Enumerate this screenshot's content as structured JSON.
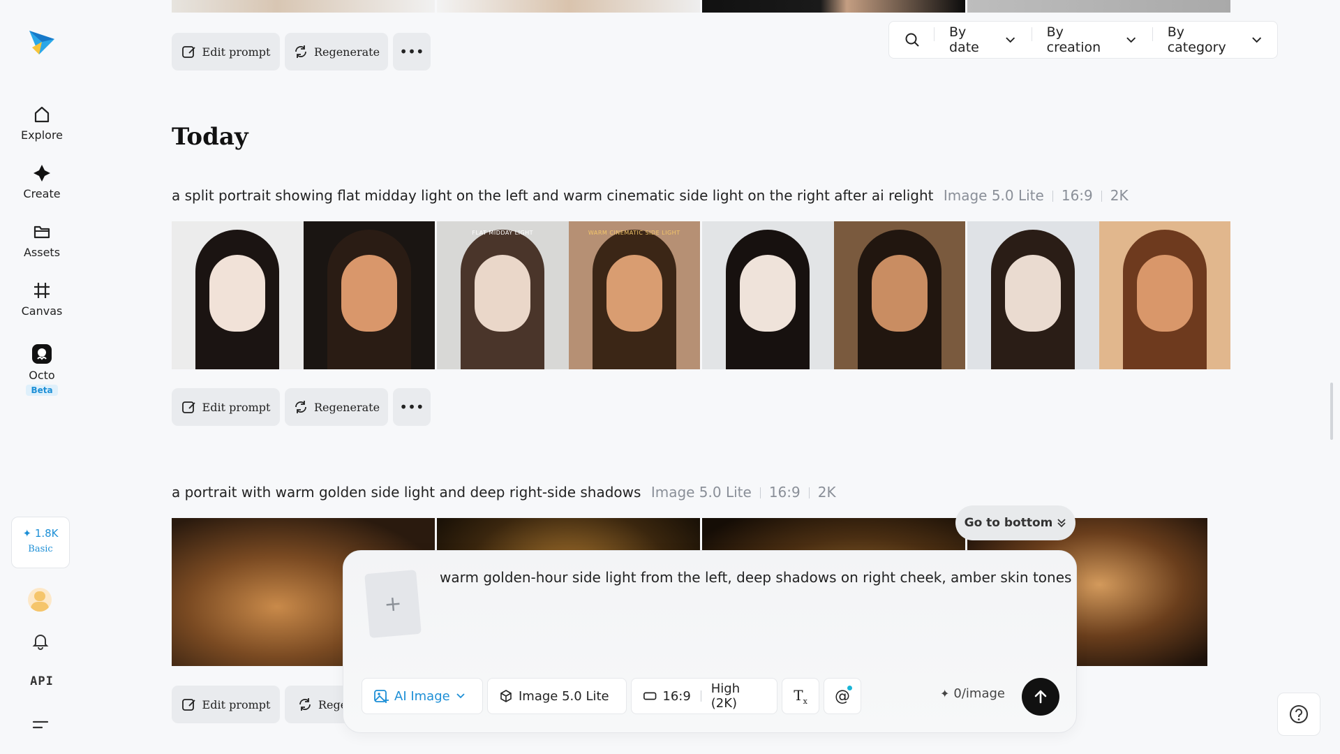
{
  "sidebar": {
    "items": [
      {
        "label": "Explore",
        "icon": "home-icon"
      },
      {
        "label": "Create",
        "icon": "sparkle-icon"
      },
      {
        "label": "Assets",
        "icon": "folder-icon"
      },
      {
        "label": "Canvas",
        "icon": "canvas-icon"
      },
      {
        "label": "Octo",
        "icon": "octo-icon",
        "badge": "Beta"
      }
    ],
    "credits": {
      "amount": "1.8K",
      "tier": "Basic"
    },
    "api_label": "API"
  },
  "actions": {
    "edit_prompt": "Edit prompt",
    "regenerate": "Regenerate",
    "regenerate_truncated": "Rege"
  },
  "filters": {
    "by_date": "By date",
    "by_creation": "By creation",
    "by_category": "By category"
  },
  "feed": {
    "section_title": "Today",
    "groups": [
      {
        "prompt": "a split portrait showing flat midday light on the left and warm cinematic side light on the right after ai relight",
        "model": "Image 5.0 Lite",
        "ratio": "16:9",
        "resolution": "2K",
        "captions": {
          "left": "FLAT MIDDAY LIGHT",
          "right": "WARM CINEMATIC SIDE LIGHT"
        }
      },
      {
        "prompt": "a portrait with warm golden side light and deep right-side shadows",
        "model": "Image 5.0 Lite",
        "ratio": "16:9",
        "resolution": "2K"
      }
    ]
  },
  "composer": {
    "prompt_text": "warm golden-hour side light from the left, deep shadows on right cheek, amber skin tones",
    "mode": "AI Image",
    "model": "Image 5.0 Lite",
    "ratio": "16:9",
    "quality": "High (2K)",
    "cost": "0/image",
    "accent_color": "#1d8fd6"
  },
  "go_to_bottom": "Go to bottom"
}
